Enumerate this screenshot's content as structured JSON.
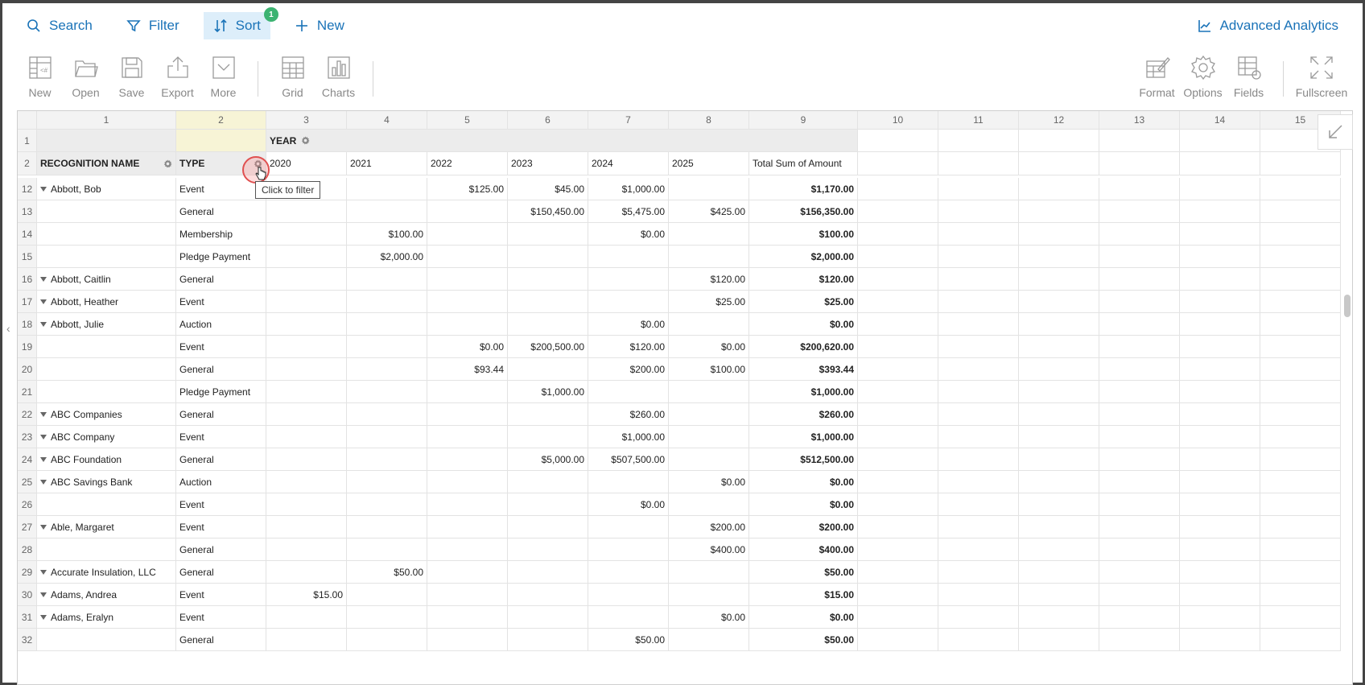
{
  "topbar": {
    "search": "Search",
    "filter": "Filter",
    "sort": "Sort",
    "sort_badge": "1",
    "new": "New",
    "advanced": "Advanced Analytics"
  },
  "toolbar": {
    "new": "New",
    "open": "Open",
    "save": "Save",
    "export": "Export",
    "more": "More",
    "grid": "Grid",
    "charts": "Charts",
    "format": "Format",
    "options": "Options",
    "fields": "Fields",
    "fullscreen": "Fullscreen"
  },
  "columns": [
    "1",
    "2",
    "3",
    "4",
    "5",
    "6",
    "7",
    "8",
    "9",
    "10",
    "11",
    "12",
    "13",
    "14",
    "15"
  ],
  "header": {
    "row1_num": "1",
    "row2_num": "2",
    "year": "YEAR",
    "recognition": "RECOGNITION NAME",
    "type": "TYPE",
    "years": [
      "2020",
      "2021",
      "2022",
      "2023",
      "2024",
      "2025"
    ],
    "total": "Total Sum of Amount"
  },
  "tooltip": "Click to filter",
  "rows": [
    {
      "n": "12",
      "name": "Abbott, Bob",
      "type": "Event",
      "v": [
        "",
        "",
        "$125.00",
        "$45.00",
        "$1,000.00",
        ""
      ],
      "t": "$1,170.00"
    },
    {
      "n": "13",
      "name": "",
      "type": "General",
      "v": [
        "",
        "",
        "",
        "$150,450.00",
        "$5,475.00",
        "$425.00"
      ],
      "t": "$156,350.00"
    },
    {
      "n": "14",
      "name": "",
      "type": "Membership",
      "v": [
        "",
        "$100.00",
        "",
        "",
        "$0.00",
        ""
      ],
      "t": "$100.00"
    },
    {
      "n": "15",
      "name": "",
      "type": "Pledge Payment",
      "v": [
        "",
        "$2,000.00",
        "",
        "",
        "",
        ""
      ],
      "t": "$2,000.00"
    },
    {
      "n": "16",
      "name": "Abbott, Caitlin",
      "type": "General",
      "v": [
        "",
        "",
        "",
        "",
        "",
        "$120.00"
      ],
      "t": "$120.00"
    },
    {
      "n": "17",
      "name": "Abbott, Heather",
      "type": "Event",
      "v": [
        "",
        "",
        "",
        "",
        "",
        "$25.00"
      ],
      "t": "$25.00"
    },
    {
      "n": "18",
      "name": "Abbott, Julie",
      "type": "Auction",
      "v": [
        "",
        "",
        "",
        "",
        "$0.00",
        ""
      ],
      "t": "$0.00"
    },
    {
      "n": "19",
      "name": "",
      "type": "Event",
      "v": [
        "",
        "",
        "$0.00",
        "$200,500.00",
        "$120.00",
        "$0.00"
      ],
      "t": "$200,620.00"
    },
    {
      "n": "20",
      "name": "",
      "type": "General",
      "v": [
        "",
        "",
        "$93.44",
        "",
        "$200.00",
        "$100.00"
      ],
      "t": "$393.44"
    },
    {
      "n": "21",
      "name": "",
      "type": "Pledge Payment",
      "v": [
        "",
        "",
        "",
        "$1,000.00",
        "",
        ""
      ],
      "t": "$1,000.00"
    },
    {
      "n": "22",
      "name": "ABC Companies",
      "type": "General",
      "v": [
        "",
        "",
        "",
        "",
        "$260.00",
        ""
      ],
      "t": "$260.00"
    },
    {
      "n": "23",
      "name": "ABC Company",
      "type": "Event",
      "v": [
        "",
        "",
        "",
        "",
        "$1,000.00",
        ""
      ],
      "t": "$1,000.00"
    },
    {
      "n": "24",
      "name": "ABC Foundation",
      "type": "General",
      "v": [
        "",
        "",
        "",
        "$5,000.00",
        "$507,500.00",
        ""
      ],
      "t": "$512,500.00"
    },
    {
      "n": "25",
      "name": "ABC Savings Bank",
      "type": "Auction",
      "v": [
        "",
        "",
        "",
        "",
        "",
        "$0.00"
      ],
      "t": "$0.00"
    },
    {
      "n": "26",
      "name": "",
      "type": "Event",
      "v": [
        "",
        "",
        "",
        "",
        "$0.00",
        ""
      ],
      "t": "$0.00"
    },
    {
      "n": "27",
      "name": "Able, Margaret",
      "type": "Event",
      "v": [
        "",
        "",
        "",
        "",
        "",
        "$200.00"
      ],
      "t": "$200.00"
    },
    {
      "n": "28",
      "name": "",
      "type": "General",
      "v": [
        "",
        "",
        "",
        "",
        "",
        "$400.00"
      ],
      "t": "$400.00"
    },
    {
      "n": "29",
      "name": "Accurate Insulation, LLC",
      "type": "General",
      "v": [
        "",
        "$50.00",
        "",
        "",
        "",
        ""
      ],
      "t": "$50.00"
    },
    {
      "n": "30",
      "name": "Adams, Andrea",
      "type": "Event",
      "v": [
        "$15.00",
        "",
        "",
        "",
        "",
        ""
      ],
      "t": "$15.00"
    },
    {
      "n": "31",
      "name": "Adams, Eralyn",
      "type": "Event",
      "v": [
        "",
        "",
        "",
        "",
        "",
        "$0.00"
      ],
      "t": "$0.00"
    },
    {
      "n": "32",
      "name": "",
      "type": "General",
      "v": [
        "",
        "",
        "",
        "",
        "$50.00",
        ""
      ],
      "t": "$50.00"
    }
  ]
}
